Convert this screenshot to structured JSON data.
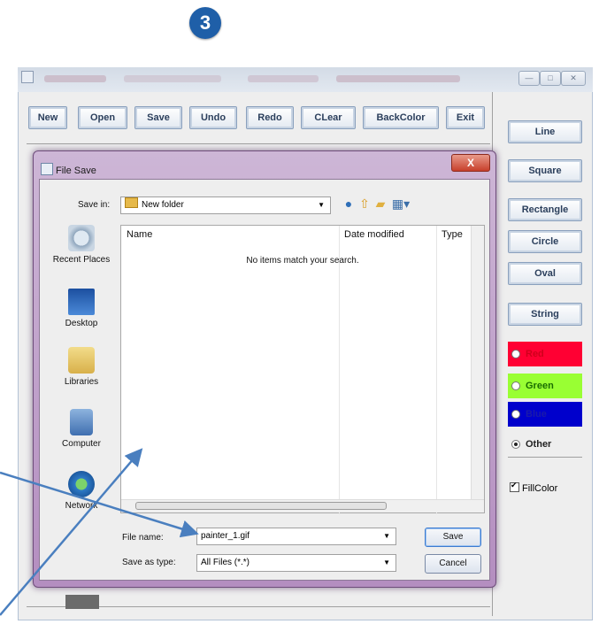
{
  "step_badge": "3",
  "toolbar": {
    "buttons": [
      "New",
      "Open",
      "Save",
      "Undo",
      "Redo",
      "CLear",
      "BackColor",
      "Exit"
    ]
  },
  "side_panel": {
    "shapes": [
      "Line",
      "Square",
      "Rectangle",
      "Circle",
      "Oval",
      "String"
    ],
    "colors": [
      {
        "label": "Red",
        "bg": "#ff0033",
        "fg": "#d0001c"
      },
      {
        "label": "Green",
        "bg": "#99ff33",
        "fg": "#1a6d00"
      },
      {
        "label": "Blue",
        "bg": "#0000cc",
        "fg": "#1a1aaa"
      },
      {
        "label": "Other",
        "bg": "#eeeeee",
        "fg": "#222222"
      }
    ],
    "selected_color": "Other",
    "fill_color_label": "FillColor",
    "fill_color_checked": true
  },
  "dialog": {
    "title": "File Save",
    "close_label": "X",
    "save_in_label": "Save in:",
    "save_in_value": "New folder",
    "places": [
      "Recent Places",
      "Desktop",
      "Libraries",
      "Computer",
      "Network"
    ],
    "columns": [
      "Name",
      "Date modified",
      "Type"
    ],
    "empty_message": "No items match your search.",
    "file_name_label": "File name:",
    "file_name_value": "painter_1.gif",
    "save_as_type_label": "Save as type:",
    "save_as_type_value": "All Files (*.*)",
    "save_button": "Save",
    "cancel_button": "Cancel"
  },
  "colors": {
    "accent": "#1f5fa8",
    "arrow": "#4a7fbf"
  }
}
